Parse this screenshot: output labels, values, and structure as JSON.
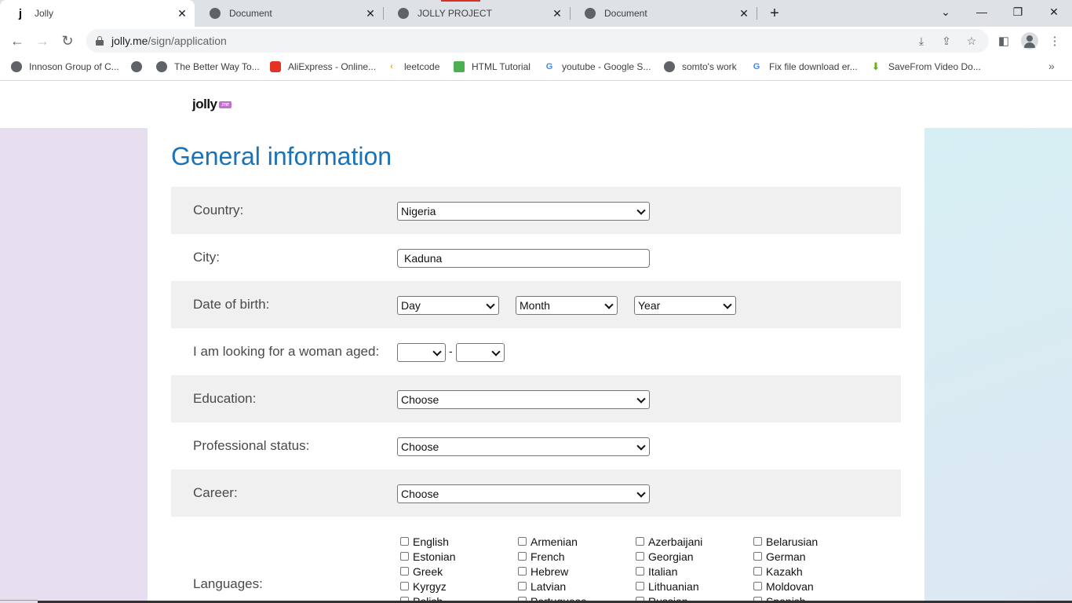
{
  "browser": {
    "tabs": [
      {
        "title": "Jolly",
        "favicon": "j"
      },
      {
        "title": "Document"
      },
      {
        "title": "JOLLY PROJECT"
      },
      {
        "title": "Document"
      }
    ],
    "new_tab": "+",
    "url_host": "jolly.me",
    "url_path": "/sign/application",
    "bookmarks": [
      "Innoson Group of C...",
      "",
      "The Better Way To...",
      "AliExpress - Online...",
      "leetcode",
      "HTML Tutorial",
      "youtube - Google S...",
      "somto's work",
      "Fix file download er...",
      "SaveFrom Video Do..."
    ]
  },
  "site": {
    "logo": "jolly",
    "logo_badge": ".me"
  },
  "form": {
    "title": "General information",
    "country": {
      "label": "Country:",
      "value": "Nigeria"
    },
    "city": {
      "label": "City:",
      "value": "Kaduna"
    },
    "dob": {
      "label": "Date of birth:",
      "day": "Day",
      "month": "Month",
      "year": "Year"
    },
    "looking": {
      "label": "I am looking for a woman aged:",
      "from": "",
      "to": "",
      "sep": "-"
    },
    "education": {
      "label": "Education:",
      "value": "Choose"
    },
    "professional": {
      "label": "Professional status:",
      "value": "Choose"
    },
    "career": {
      "label": "Career:",
      "value": "Choose"
    },
    "languages": {
      "label": "Languages:",
      "items": [
        "English",
        "Armenian",
        "Azerbaijani",
        "Belarusian",
        "Estonian",
        "French",
        "Georgian",
        "German",
        "Greek",
        "Hebrew",
        "Italian",
        "Kazakh",
        "Kyrgyz",
        "Latvian",
        "Lithuanian",
        "Moldovan",
        "Polish",
        "Portuguese",
        "Russian",
        "Spanish"
      ]
    }
  },
  "colors": {
    "title": "#1a73b8",
    "row_shade": "#f0f0f0",
    "left_bg": "#e7dff0",
    "right_bg": "#d6eff3"
  }
}
